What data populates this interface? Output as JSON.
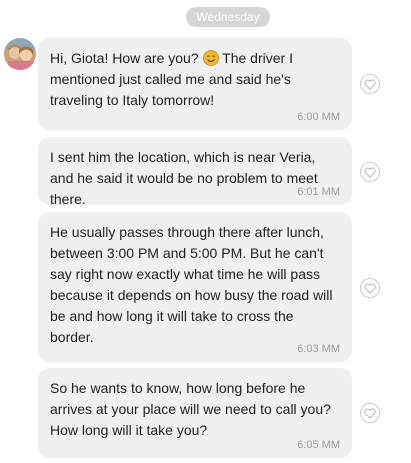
{
  "day_separator": "Wednesday",
  "messages": [
    {
      "text_before_emoji": "Hi, Giota! How are you? ",
      "emoji": "smiling-face-emoji",
      "text_after_emoji": " The driver I mentioned just called me and said he's traveling to Italy tomorrow!",
      "time": "6:00 MM"
    },
    {
      "text": "I sent him the location, which is near Veria, and he said it would be no problem to meet there.",
      "time": "6:01 MM"
    },
    {
      "text": "He usually passes through there after lunch, between 3:00 PM and 5:00 PM. But he can't say right now exactly what time he will pass because it depends on how busy the road will be and how long it will take to cross the border.",
      "time": "6:03 MM"
    },
    {
      "text": "So he wants to know, how long before he arrives at your place will we need to call you? How long will it take you?",
      "time": "6:05 MM"
    }
  ],
  "icons": {
    "like": "heart-icon",
    "avatar": "avatar"
  },
  "colors": {
    "bubble": "#f0f0f0",
    "pill": "#d6d6d6",
    "time_text": "#9a9a9a",
    "message_text": "#1f1f1f",
    "emoji": "#f5b82e"
  }
}
